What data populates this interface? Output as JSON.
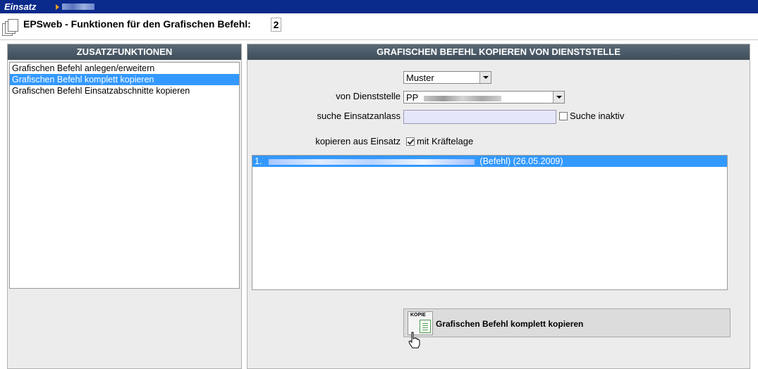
{
  "topbar": {
    "app_name": "Einsatz"
  },
  "header": {
    "title": "EPSweb - Funktionen für den Grafischen Befehl:",
    "number": "2"
  },
  "left_panel": {
    "title": "ZUSATZFUNKTIONEN",
    "items": [
      {
        "label": "Grafischen Befehl anlegen/erweitern",
        "selected": false
      },
      {
        "label": "Grafischen Befehl komplett kopieren",
        "selected": true
      },
      {
        "label": "Grafischen Befehl Einsatzabschnitte kopieren",
        "selected": false
      }
    ]
  },
  "right_panel": {
    "title": "GRAFISCHEN BEFEHL KOPIEREN VON DIENSTSTELLE",
    "muster_select": {
      "value": "Muster"
    },
    "dienststelle": {
      "label": "von Dienststelle",
      "value_prefix": "PP"
    },
    "suche": {
      "label": "suche Einsatzanlass",
      "value": "",
      "inactive_label": "Suche inaktiv",
      "inactive_checked": false
    },
    "kopieren": {
      "label": "kopieren aus Einsatz",
      "kraeftelage_label": "mit Kräftelage",
      "kraeftelage_checked": true
    },
    "results": [
      {
        "prefix": "1.",
        "suffix": "(Befehl) (26.05.2009)"
      }
    ],
    "action_button": {
      "icon_text": "KOPIE",
      "label": "Grafischen Befehl komplett kopieren"
    }
  },
  "colors": {
    "topbar": "#0a2a8c",
    "panel_header": "#4a5866",
    "selection": "#3399ff"
  }
}
